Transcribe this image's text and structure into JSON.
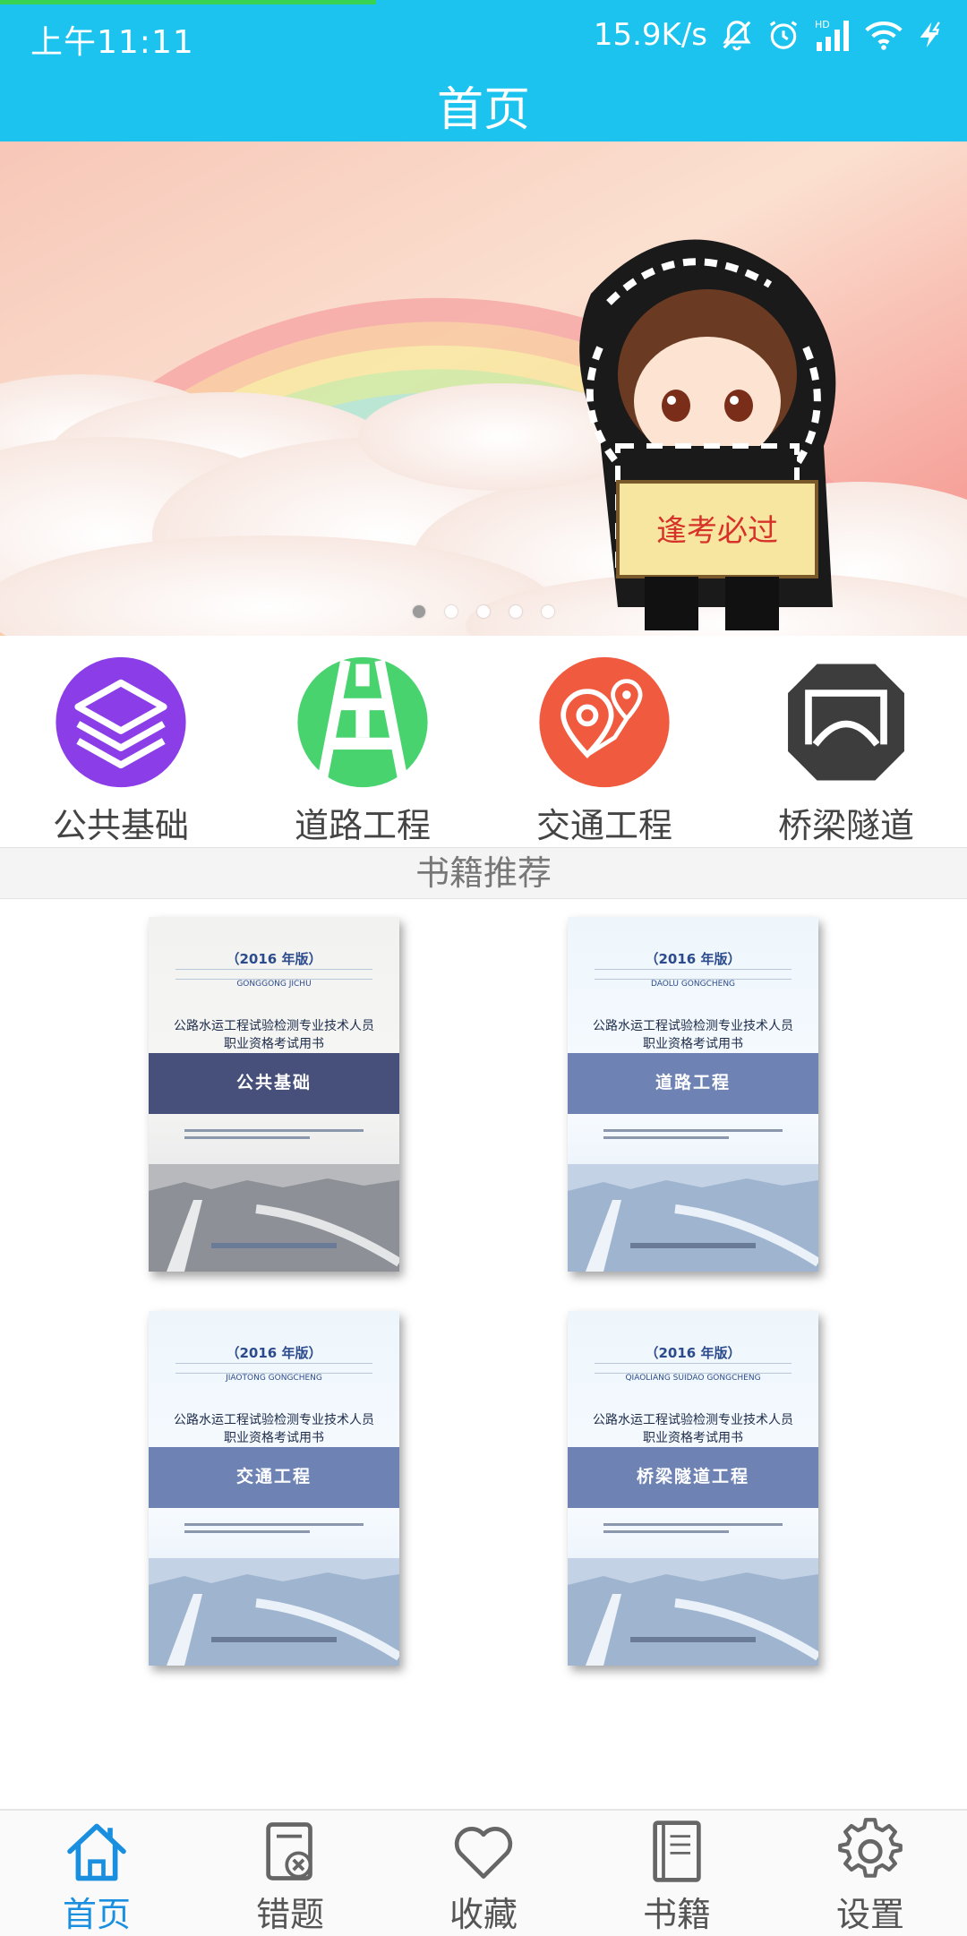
{
  "status_bar": {
    "time": "上午11:11",
    "speed": "15.9K/s",
    "network": "HD"
  },
  "header": {
    "title": "首页"
  },
  "banner": {
    "sign_text": "逢考必过",
    "slide_count": 5,
    "active_slide": 0
  },
  "categories": [
    {
      "label": "公共基础",
      "icon": "layers-icon",
      "color": "#8b3ee8"
    },
    {
      "label": "道路工程",
      "icon": "road-icon",
      "color": "#49d36e"
    },
    {
      "label": "交通工程",
      "icon": "map-pin-icon",
      "color": "#f05a3f"
    },
    {
      "label": "桥梁隧道",
      "icon": "tunnel-icon",
      "color": "#3d3d3d"
    }
  ],
  "section": {
    "title": "书籍推荐"
  },
  "books": [
    {
      "edition": "（2016 年版）",
      "pinyin": "GONGGONG JICHU",
      "series": "公路水运工程试验检测专业技术人员",
      "series2": "职业资格考试用书",
      "name": "公共基础"
    },
    {
      "edition": "（2016 年版）",
      "pinyin": "DAOLU GONGCHENG",
      "series": "公路水运工程试验检测专业技术人员",
      "series2": "职业资格考试用书",
      "name": "道路工程"
    },
    {
      "edition": "（2016 年版）",
      "pinyin": "JIAOTONG GONGCHENG",
      "series": "公路水运工程试验检测专业技术人员",
      "series2": "职业资格考试用书",
      "name": "交通工程"
    },
    {
      "edition": "（2016 年版）",
      "pinyin": "QIAOLIANG SUIDAO GONGCHENG",
      "series": "公路水运工程试验检测专业技术人员",
      "series2": "职业资格考试用书",
      "name": "桥梁隧道工程"
    }
  ],
  "bottom_nav": [
    {
      "label": "首页",
      "icon": "home-icon",
      "active": true
    },
    {
      "label": "错题",
      "icon": "wrong-questions-icon",
      "active": false
    },
    {
      "label": "收藏",
      "icon": "heart-icon",
      "active": false
    },
    {
      "label": "书籍",
      "icon": "book-icon",
      "active": false
    },
    {
      "label": "设置",
      "icon": "gear-icon",
      "active": false
    }
  ],
  "colors": {
    "header": "#1bc3ee",
    "nav_active": "#1a8fe0",
    "nav_inactive": "#555555"
  }
}
